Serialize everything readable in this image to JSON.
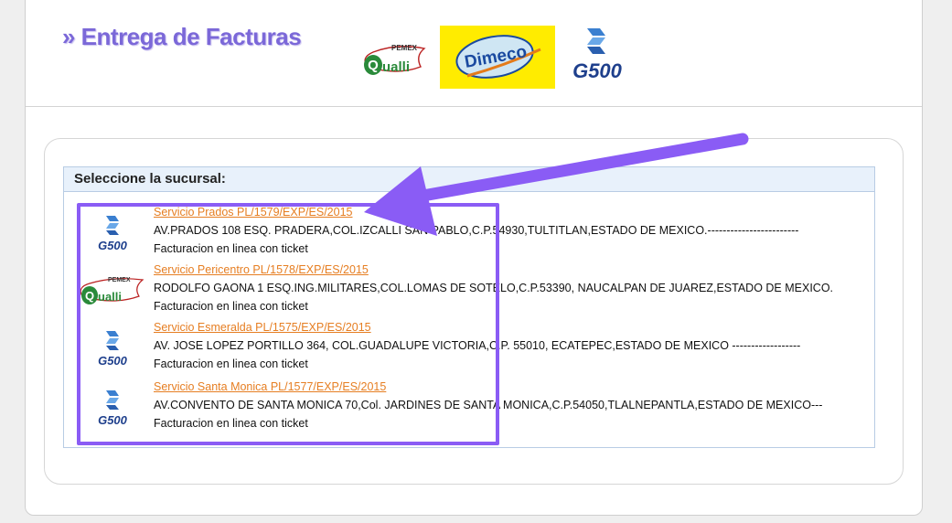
{
  "header": {
    "title": "» Entrega de Facturas",
    "logos": [
      "pemex-qualli-logo",
      "dimeco-logo",
      "g500-logo"
    ],
    "qualli_top": "PEMEX",
    "qualli_word": "ualli",
    "dimeco_word": "Dimeco",
    "g500_word": "G500"
  },
  "panel": {
    "heading": "Seleccione la sucursal:"
  },
  "branches": [
    {
      "logo": "g500-logo",
      "logo_text": "G500",
      "name": "Servicio Prados PL/1579/EXP/ES/2015",
      "address": "AV.PRADOS 108 ESQ. PRADERA,COL.IZCALLI SAN PABLO,C.P.54930,TULTITLAN,ESTADO DE MEXICO.------------------------",
      "note": "Facturacion en linea con ticket"
    },
    {
      "logo": "pemex-qualli-logo",
      "logo_text": "ualli",
      "name": "Servicio Pericentro PL/1578/EXP/ES/2015",
      "address": "RODOLFO GAONA 1 ESQ.ING.MILITARES,COL.LOMAS DE SOTELO,C.P.53390, NAUCALPAN DE JUAREZ,ESTADO DE MEXICO.",
      "note": "Facturacion en linea con ticket"
    },
    {
      "logo": "g500-logo",
      "logo_text": "G500",
      "name": "Servicio Esmeralda PL/1575/EXP/ES/2015",
      "address": "AV. JOSE LOPEZ PORTILLO 364, COL.GUADALUPE VICTORIA,C.P. 55010, ECATEPEC,ESTADO DE MEXICO ------------------",
      "note": "Facturacion en linea con ticket"
    },
    {
      "logo": "g500-logo",
      "logo_text": "G500",
      "name": "Servicio Santa Monica PL/1577/EXP/ES/2015",
      "address": "AV.CONVENTO DE SANTA MONICA 70,Col. JARDINES DE SANTA MONICA,C.P.54050,TLALNEPANTLA,ESTADO DE MEXICO---",
      "note": "Facturacion en linea con ticket"
    }
  ],
  "colors": {
    "title": "#7b68d8",
    "link": "#e67e22",
    "highlight": "#8a5cf5",
    "panel_border": "#b8cce4"
  }
}
